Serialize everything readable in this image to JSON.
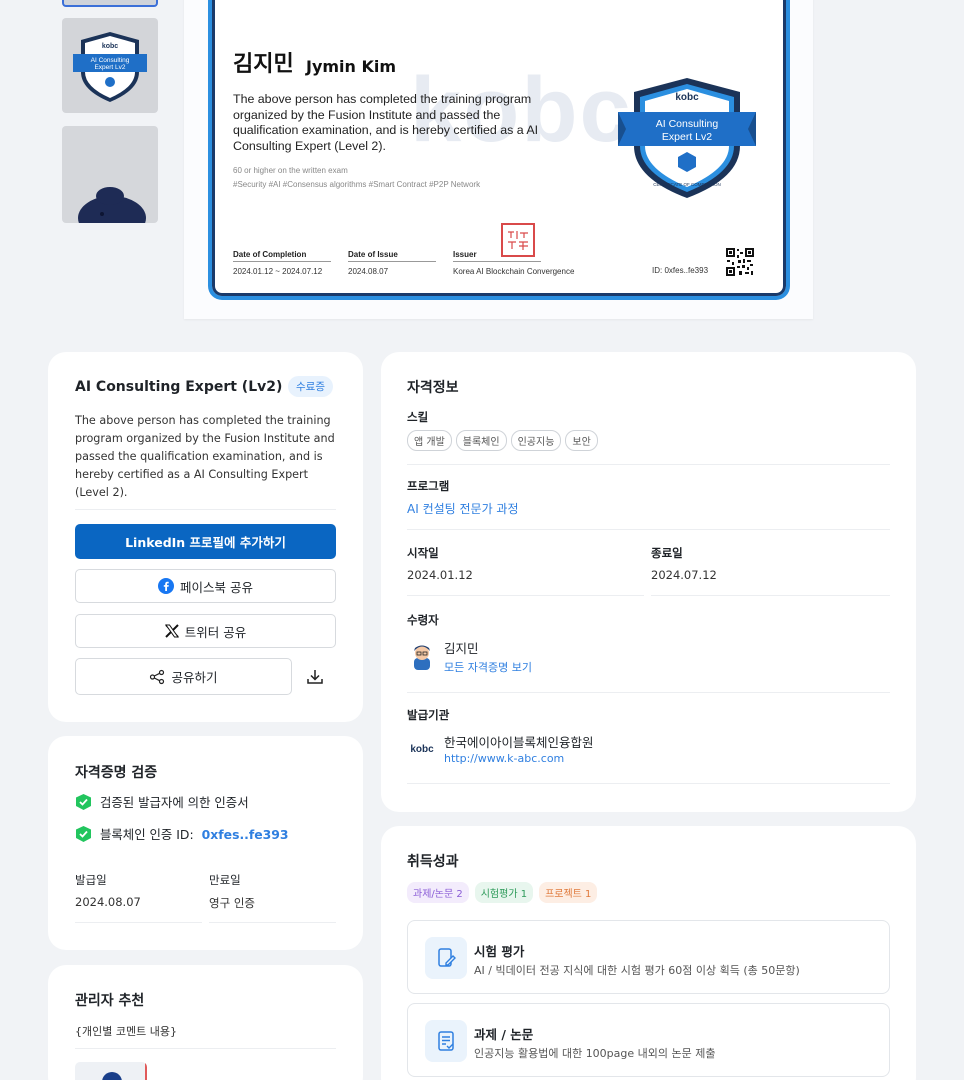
{
  "certificate": {
    "name_ko": "김지민",
    "name_en": "Jymin Kim",
    "description": "The above person has completed the training program organized by the Fusion Institute and passed the qualification examination, and is hereby certified as a AI Consulting Expert (Level 2).",
    "exam_note": "60 or higher on the written exam",
    "tags": "#Security  #AI  #Consensus algorithms  #Smart Contract  #P2P Network",
    "watermark": "kobc",
    "badge_brand": "kobc",
    "badge_line1": "AI Consulting",
    "badge_line2": "Expert Lv2",
    "badge_ribbon": "CERTIFICATE OF COMPLETION",
    "completion_label": "Date of Completion",
    "completion_value": "2024.01.12 ~ 2024.07.12",
    "issue_label": "Date of Issue",
    "issue_value": "2024.08.07",
    "issuer_label": "Issuer",
    "issuer_value": "Korea AI Blockchain Convergence",
    "id_text": "ID: 0xfes..fe393"
  },
  "summary": {
    "title": "AI Consulting Expert (Lv2)",
    "badge": "수료증",
    "description": "The above person has completed the training program organized by the Fusion Institute and passed the qualification examination, and is hereby certified as a AI Consulting Expert (Level 2).",
    "linkedin_label": "LinkedIn 프로필에 추가하기",
    "facebook_label": "페이스북 공유",
    "twitter_label": "트위터 공유",
    "share_label": "공유하기"
  },
  "verify": {
    "title": "자격증명 검증",
    "check1": "검증된 발급자에 의한 인증서",
    "check2_label": "블록체인 인증 ID:",
    "check2_hash": "0xfes..fe393",
    "issue_label": "발급일",
    "issue_value": "2024.08.07",
    "expire_label": "만료일",
    "expire_value": "영구 인증"
  },
  "recommend": {
    "title": "관리자 추천",
    "comment": "{개인별 코멘트 내용}"
  },
  "info": {
    "title": "자격정보",
    "skill_label": "스킬",
    "skills": [
      "앱 개발",
      "블록체인",
      "인공지능",
      "보안"
    ],
    "program_label": "프로그램",
    "program_value": "AI 컨설팅 전문가 과정",
    "start_label": "시작일",
    "start_value": "2024.01.12",
    "end_label": "종료일",
    "end_value": "2024.07.12",
    "recipient_label": "수령자",
    "recipient_name": "김지민",
    "recipient_link": "모든 자격증명 보기",
    "org_label": "발급기관",
    "org_name": "한국에이아이블록체인융합원",
    "org_url": "http://www.k-abc.com",
    "org_logo": "kobc"
  },
  "achievements": {
    "title": "취득성과",
    "tags": [
      {
        "label": "과제/논문 2",
        "color": "#8a5cd6",
        "bg": "#f3ecfc"
      },
      {
        "label": "시험평가 1",
        "color": "#2e9b5a",
        "bg": "#e8f6ee"
      },
      {
        "label": "프로젝트 1",
        "color": "#e07a3c",
        "bg": "#fdeee4"
      }
    ],
    "items": [
      {
        "title": "시험 평가",
        "desc": "AI / 빅데이터 전공 지식에 대한 시험 평가 60점 이상 획득 (총 50문항)"
      },
      {
        "title": "과제 / 논문",
        "desc": "인공지능 활용법에 대한 100page 내외의 논문 제출"
      }
    ]
  },
  "colors": {
    "accent": "#2f7fe0",
    "linkedin": "#0a66c2",
    "check": "#22c55e",
    "badge_navy": "#1b3358"
  }
}
